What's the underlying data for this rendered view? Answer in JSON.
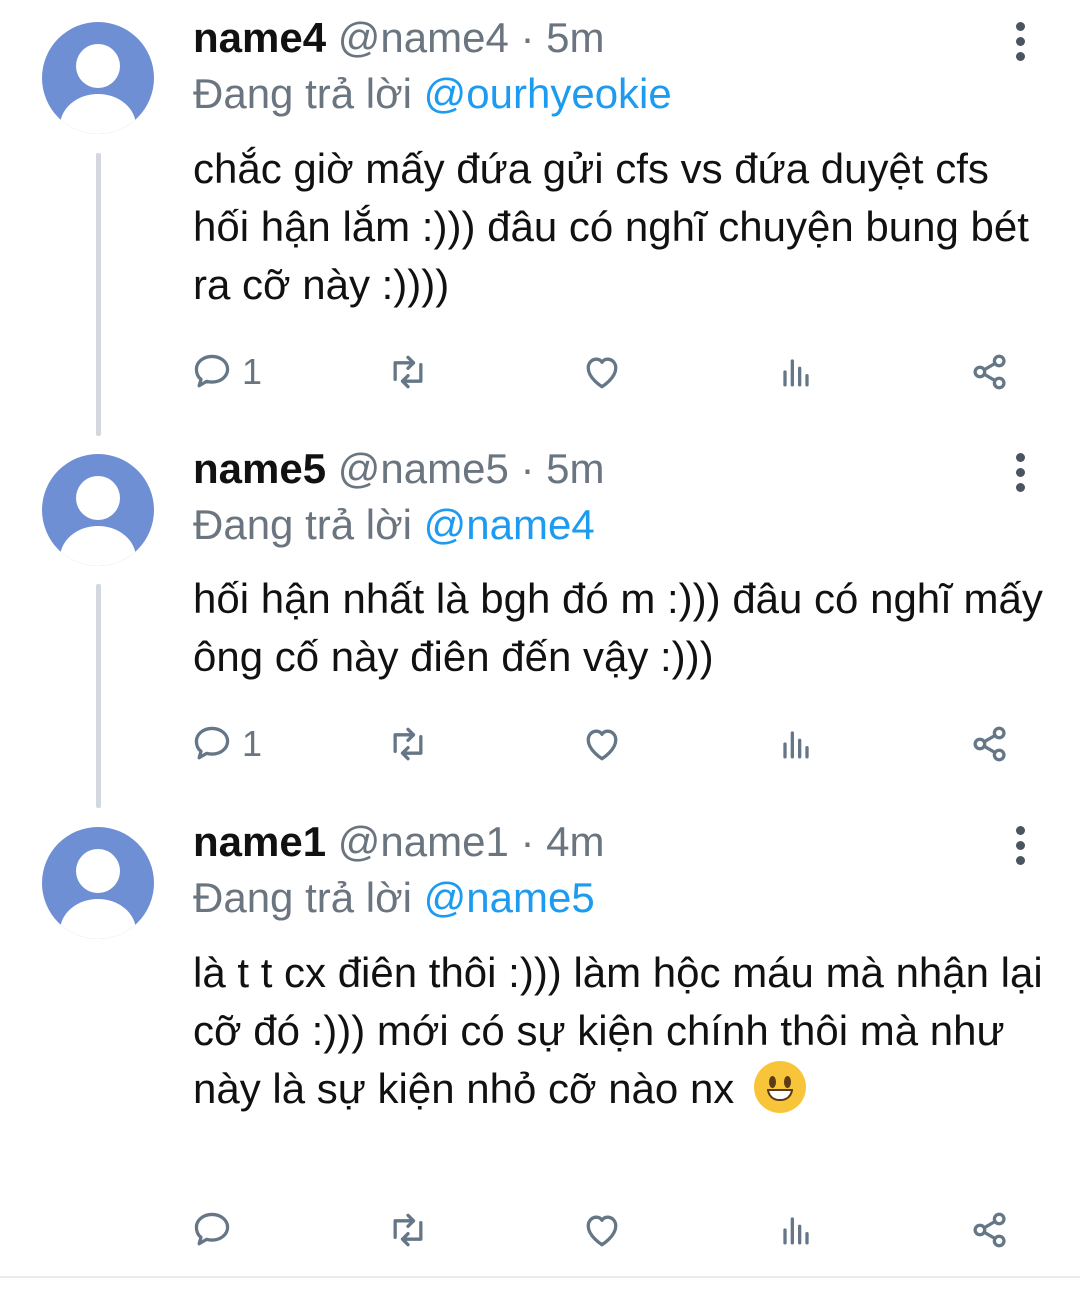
{
  "tweets": [
    {
      "name": "name4",
      "handle": "@name4",
      "time": "· 5m",
      "reply_prefix": "Đang trả lời",
      "reply_to": "@ourhyeokie",
      "text": "chắc giờ mấy đứa gửi cfs vs đứa duyệt cfs hối hận lắm :))) đâu có nghĩ chuyện bung bét ra cỡ này :))))",
      "reply_count": "1"
    },
    {
      "name": "name5",
      "handle": "@name5",
      "time": "· 5m",
      "reply_prefix": "Đang trả lời",
      "reply_to": "@name4",
      "text": "hối hận nhất là bgh đó m :))) đâu có nghĩ mấy ông cố này điên đến vậy :)))",
      "reply_count": "1"
    },
    {
      "name": "name1",
      "handle": "@name1",
      "time": "· 4m",
      "reply_prefix": "Đang trả lời",
      "reply_to": "@name5",
      "text": "là t t cx điên thôi :))) làm hộc máu mà nhận lại cỡ đó :))) mới có sự kiện chính thôi mà như này là sự kiện nhỏ cỡ nào nx",
      "emoji": "grinning-face-emoji",
      "reply_count": ""
    }
  ],
  "icons": {
    "reply": "comment-icon",
    "retweet": "retweet-icon",
    "like": "heart-icon",
    "views": "analytics-icon",
    "share": "share-icon",
    "more": "more-vertical-icon"
  },
  "colors": {
    "mention": "#1d9bf0",
    "meta": "#6b7580",
    "avatar": "#6f8fd4",
    "thread_line": "#d2d8de"
  }
}
